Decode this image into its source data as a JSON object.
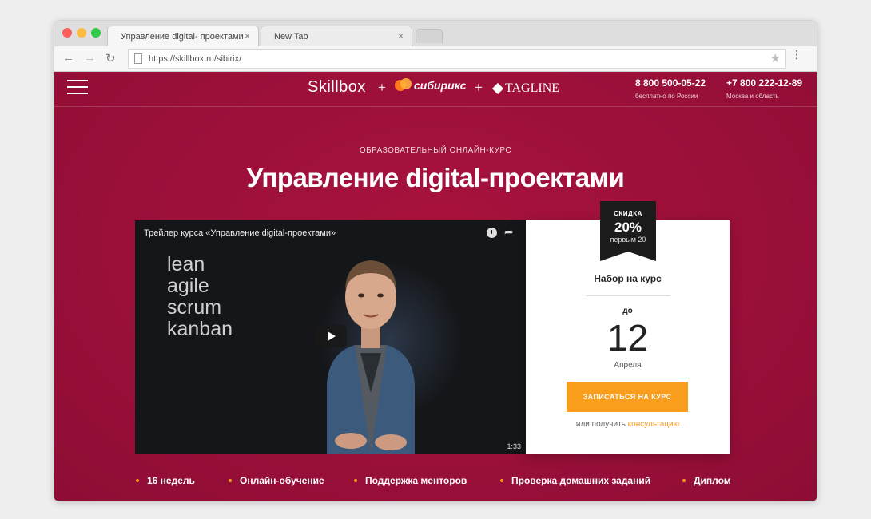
{
  "browser": {
    "tabs": [
      {
        "label": "Управление digital- проектами",
        "close": "×"
      },
      {
        "label": "New Tab",
        "close": "×"
      }
    ],
    "nav": {
      "back": "←",
      "forward": "→",
      "reload": "↻"
    },
    "url": "https://skillbox.ru/sibirix/",
    "star": "★",
    "menu": "⋮"
  },
  "header": {
    "logo_skillbox": "Skillbox",
    "plus": "+",
    "logo_bitrix": "сибирикс",
    "logo_tagline": "TAGLINE",
    "phones": [
      {
        "number": "8 800 500-05-22",
        "caption": "бесплатно по России"
      },
      {
        "number": "+7 800 222-12-89",
        "caption": "Москва и область"
      }
    ]
  },
  "hero": {
    "eyebrow": "ОБРАЗОВАТЕЛЬНЫЙ ОНЛАЙН-КУРС",
    "title": "Управление digital-проектами"
  },
  "video": {
    "title": "Трейлер курса «Управление digital-проектами»",
    "words": [
      "lean",
      "agile",
      "scrum",
      "kanban"
    ],
    "duration": "1:33"
  },
  "panel": {
    "discount_label": "СКИДКА",
    "discount_value": "20%",
    "discount_note": "первым 20",
    "enroll_title": "Набор на курс",
    "until": "до",
    "day": "12",
    "month": "Апреля",
    "cta": "ЗАПИСАТЬСЯ НА КУРС",
    "consult_prefix": "или получить",
    "consult_link": "консультацию"
  },
  "features": [
    "16 недель",
    "Онлайн-обучение",
    "Поддержка менторов",
    "Проверка домашних заданий",
    "Диплом"
  ],
  "colors": {
    "brand": "#a8123d",
    "accent": "#f99d1c"
  }
}
